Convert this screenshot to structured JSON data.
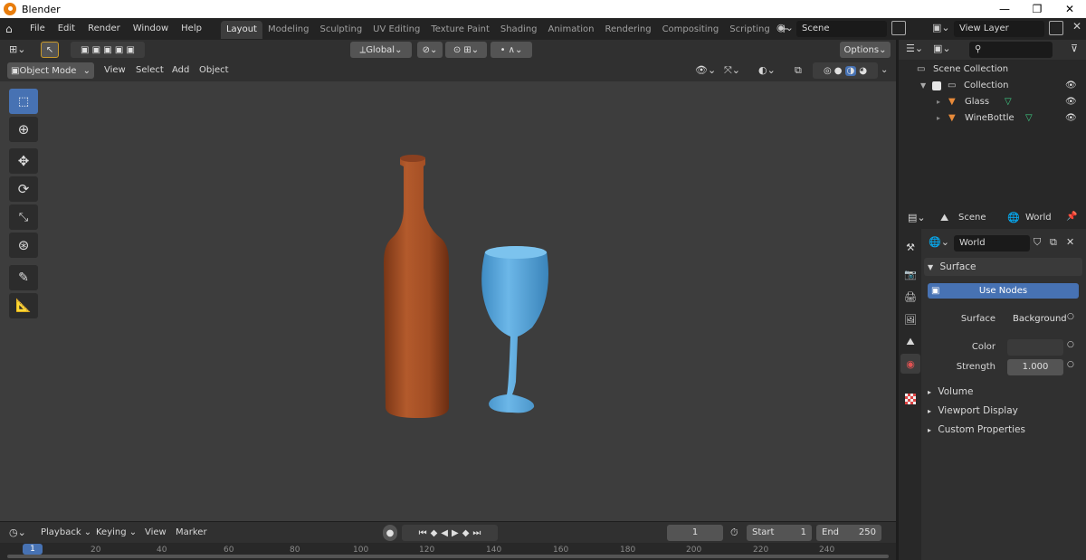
{
  "titlebar": {
    "title": "Blender",
    "minimize": "—",
    "restore": "❐",
    "close": "✕"
  },
  "menu": [
    "File",
    "Edit",
    "Render",
    "Window",
    "Help"
  ],
  "workspaces": [
    "Layout",
    "Modeling",
    "Sculpting",
    "UV Editing",
    "Texture Paint",
    "Shading",
    "Animation",
    "Rendering",
    "Compositing",
    "Scripting"
  ],
  "scene": {
    "label": "Scene",
    "view_layer": "View Layer"
  },
  "viewport": {
    "mode": "Object Mode",
    "menu": [
      "View",
      "Select",
      "Add",
      "Object"
    ],
    "orientation": "Global",
    "options": "Options"
  },
  "outliner": {
    "root": "Scene Collection",
    "collection": "Collection",
    "items": [
      "Glass",
      "WineBottle"
    ]
  },
  "properties": {
    "tab_scene": "Scene",
    "tab_world": "World",
    "world_name": "World",
    "surface_section": "Surface",
    "use_nodes": "Use Nodes",
    "surface_label": "Surface",
    "surface_value": "Background",
    "color_label": "Color",
    "strength_label": "Strength",
    "strength_value": "1.000",
    "sections": [
      "Volume",
      "Viewport Display",
      "Custom Properties"
    ]
  },
  "timeline": {
    "menu": [
      "Playback",
      "Keying",
      "View",
      "Marker"
    ],
    "current_frame": "1",
    "start_label": "Start",
    "start_value": "1",
    "end_label": "End",
    "end_value": "250",
    "ticks": [
      "1",
      "20",
      "40",
      "60",
      "80",
      "100",
      "120",
      "140",
      "160",
      "180",
      "200",
      "220",
      "240"
    ]
  },
  "colors": {
    "accent": "#4772b3",
    "bottle": "#b2582a",
    "glass": "#5aa6d8"
  }
}
